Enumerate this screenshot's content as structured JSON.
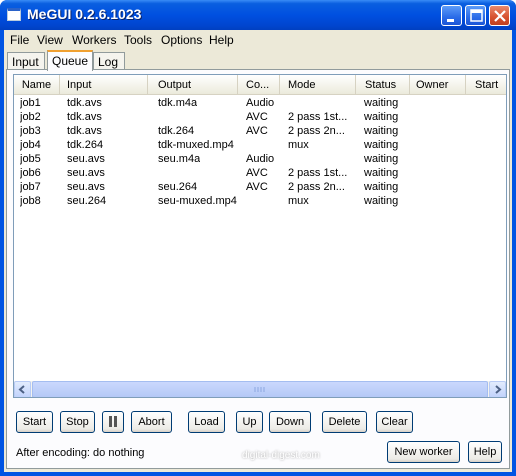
{
  "window": {
    "title": "MeGUI 0.2.6.1023"
  },
  "menu": [
    "File",
    "View",
    "Workers",
    "Tools",
    "Options",
    "Help"
  ],
  "tabs": [
    "Input",
    "Queue",
    "Log"
  ],
  "active_tab": "Queue",
  "columns": [
    "Name",
    "Input",
    "Output",
    "Co...",
    "Mode",
    "Status",
    "Owner",
    "Start"
  ],
  "jobs": [
    {
      "name": "job1",
      "input": "tdk.avs",
      "output": "tdk.m4a",
      "codec": "Audio",
      "mode": "",
      "status": "waiting"
    },
    {
      "name": "job2",
      "input": "tdk.avs",
      "output": "",
      "codec": "AVC",
      "mode": "2 pass 1st...",
      "status": "waiting"
    },
    {
      "name": "job3",
      "input": "tdk.avs",
      "output": "tdk.264",
      "codec": "AVC",
      "mode": "2 pass 2n...",
      "status": "waiting"
    },
    {
      "name": "job4",
      "input": "tdk.264",
      "output": "tdk-muxed.mp4",
      "codec": "",
      "mode": "mux",
      "status": "waiting"
    },
    {
      "name": "job5",
      "input": "seu.avs",
      "output": "seu.m4a",
      "codec": "Audio",
      "mode": "",
      "status": "waiting"
    },
    {
      "name": "job6",
      "input": "seu.avs",
      "output": "",
      "codec": "AVC",
      "mode": "2 pass 1st...",
      "status": "waiting"
    },
    {
      "name": "job7",
      "input": "seu.avs",
      "output": "seu.264",
      "codec": "AVC",
      "mode": "2 pass 2n...",
      "status": "waiting"
    },
    {
      "name": "job8",
      "input": "seu.264",
      "output": "seu-muxed.mp4",
      "codec": "",
      "mode": "mux",
      "status": "waiting"
    }
  ],
  "buttons": {
    "start": "Start",
    "stop": "Stop",
    "abort": "Abort",
    "load": "Load",
    "up": "Up",
    "down": "Down",
    "delete": "Delete",
    "clear": "Clear",
    "new_worker": "New worker",
    "help": "Help"
  },
  "after_encoding": "After encoding: do nothing",
  "watermark": "digital-digest.com",
  "colors": {
    "titlebar": "#0054e3",
    "client": "#ece9d8",
    "tab_highlight": "#f0a030"
  }
}
